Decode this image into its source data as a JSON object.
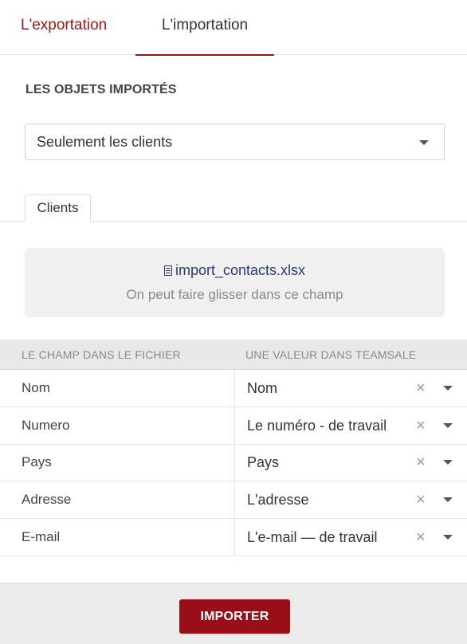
{
  "tabs": [
    {
      "label": "L'exportation",
      "active": false
    },
    {
      "label": "L'importation",
      "active": true
    }
  ],
  "accent_color": "#a31515",
  "imported_objects": {
    "title": "LES OBJETS IMPORTÉS",
    "selected": "Seulement les clients"
  },
  "subtabs": [
    {
      "label": "Clients",
      "active": true
    }
  ],
  "dropzone": {
    "icon": "file-icon",
    "file_name": "import_contacts.xlsx",
    "hint": "On peut faire glisser dans ce champ"
  },
  "mapping": {
    "headers": [
      "LE CHAMP DANS LE FICHIER",
      "UNE VALEUR DANS TEAMSALE"
    ],
    "clear_icon": "close-icon",
    "rows": [
      {
        "file_field": "Nom",
        "value": "Nom"
      },
      {
        "file_field": "Numero",
        "value": "Le numéro - de travail"
      },
      {
        "file_field": "Pays",
        "value": "Pays"
      },
      {
        "file_field": "Adresse",
        "value": "L'adresse"
      },
      {
        "file_field": "E-mail",
        "value": "L'e-mail — de travail"
      }
    ]
  },
  "footer": {
    "import_label": "IMPORTER",
    "button_color": "#9a0f17"
  }
}
